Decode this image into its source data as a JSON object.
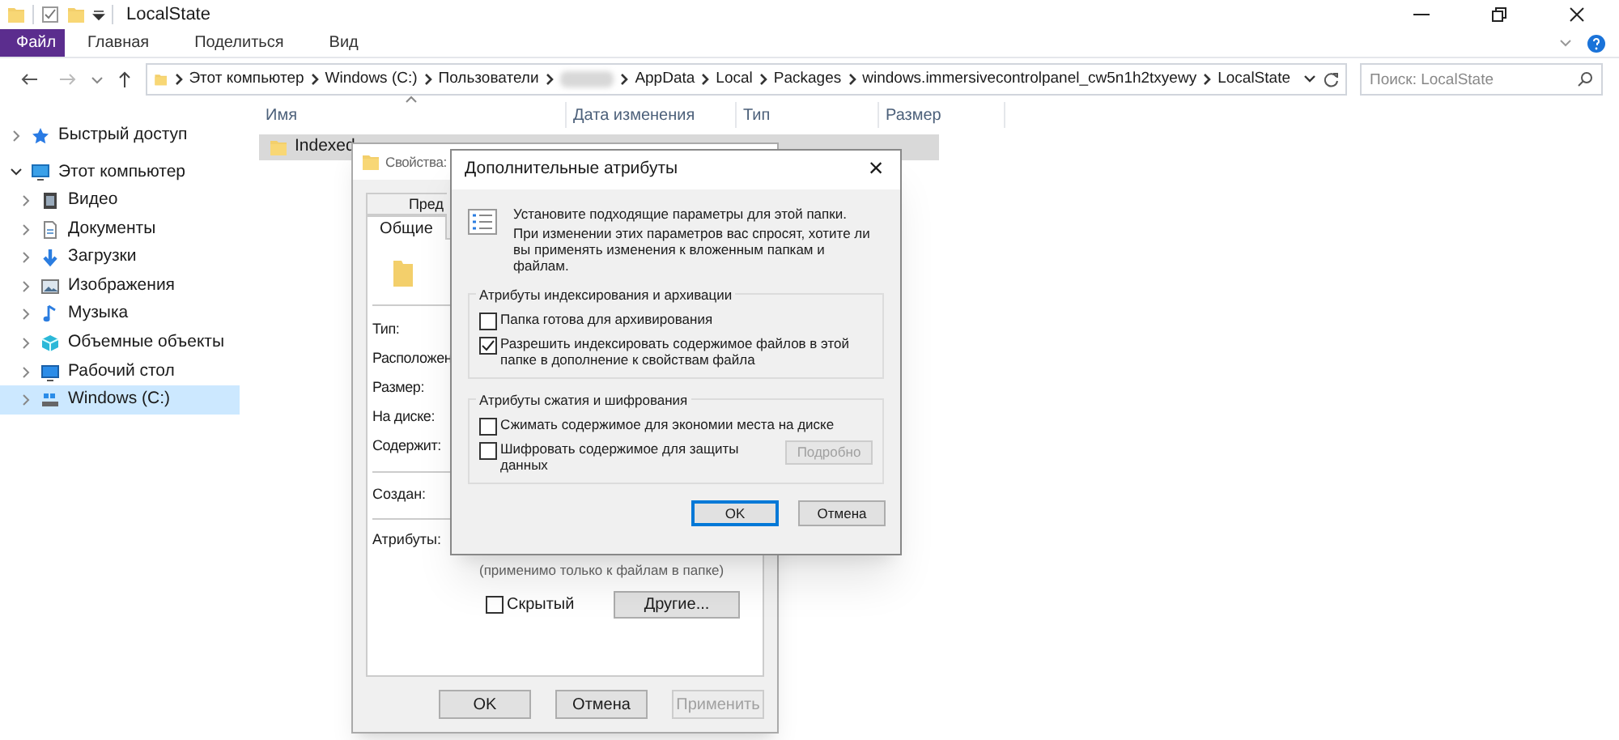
{
  "window": {
    "title": "LocalState"
  },
  "ribbon_tabs": [
    {
      "label": "Файл",
      "selected": true
    },
    {
      "label": "Главная",
      "selected": false
    },
    {
      "label": "Поделиться",
      "selected": false
    },
    {
      "label": "Вид",
      "selected": false
    }
  ],
  "address_bar": {
    "segments": [
      {
        "kind": "text",
        "label": "Этот компьютер"
      },
      {
        "kind": "text",
        "label": "Windows (C:)"
      },
      {
        "kind": "text",
        "label": "Пользователи"
      },
      {
        "kind": "redacted"
      },
      {
        "kind": "text",
        "label": "AppData"
      },
      {
        "kind": "text",
        "label": "Local"
      },
      {
        "kind": "text",
        "label": "Packages"
      },
      {
        "kind": "text",
        "label": "windows.immersivecontrolpanel_cw5n1h2txyewy"
      },
      {
        "kind": "text",
        "label": "LocalState"
      }
    ]
  },
  "search": {
    "placeholder": "Поиск: LocalState"
  },
  "sidebar": {
    "items": [
      {
        "kind": "star",
        "label": "Быстрый доступ",
        "expanded": false,
        "selected": false
      },
      {
        "kind": "computer",
        "label": "Этот компьютер",
        "expanded": true,
        "selected": false,
        "children": [
          {
            "kind": "video",
            "label": "Видео",
            "expanded": false,
            "selected": false
          },
          {
            "kind": "document",
            "label": "Документы",
            "expanded": false,
            "selected": false
          },
          {
            "kind": "download",
            "label": "Загрузки",
            "expanded": false,
            "selected": false
          },
          {
            "kind": "image",
            "label": "Изображения",
            "expanded": false,
            "selected": false
          },
          {
            "kind": "music",
            "label": "Музыка",
            "expanded": false,
            "selected": false
          },
          {
            "kind": "cube",
            "label": "Объемные объекты",
            "expanded": false,
            "selected": false
          },
          {
            "kind": "desktop",
            "label": "Рабочий стол",
            "expanded": false,
            "selected": false
          },
          {
            "kind": "drive",
            "label": "Windows (C:)",
            "expanded": false,
            "selected": true
          }
        ]
      }
    ]
  },
  "file_list": {
    "columns": [
      "Имя",
      "Дата изменения",
      "Тип",
      "Размер"
    ],
    "rows": [
      {
        "name": "Indexed",
        "selected": true
      }
    ]
  },
  "properties_dialog": {
    "title": "Свойства:",
    "tabs": [
      {
        "label": "Пред",
        "selected": false
      },
      {
        "label": "Общие",
        "selected": true
      }
    ],
    "fields": [
      "Тип:",
      "Расположен",
      "Размер:",
      "На диске:",
      "Содержит:"
    ],
    "created_label": "Создан:",
    "attributes_label": "Атрибуты:",
    "note": "(применимо только к файлам в папке)",
    "hidden_checkbox": {
      "label": "Скрытый",
      "checked": false
    },
    "other_button": "Другие...",
    "buttons": [
      {
        "label": "OK",
        "disabled": false
      },
      {
        "label": "Отмена",
        "disabled": false
      },
      {
        "label": "Применить",
        "disabled": true
      }
    ]
  },
  "advanced_dialog": {
    "title": "Дополнительные атрибуты",
    "close": "×",
    "intro": "Установите подходящие параметры для этой папки.",
    "description": "При изменении этих параметров вас спросят, хотите ли вы применять изменения к вложенным папкам и файлам.",
    "groups": [
      {
        "title": "Атрибуты индексирования и архивации",
        "options": [
          {
            "label": "Папка готова для архивирования",
            "checked": false
          },
          {
            "label": "Разрешить индексировать содержимое файлов в этой папке в дополнение к свойствам файла",
            "checked": true
          }
        ]
      },
      {
        "title": "Атрибуты сжатия и шифрования",
        "options": [
          {
            "label": "Сжимать содержимое для экономии места на диске",
            "checked": false
          },
          {
            "label": "Шифровать содержимое для защиты данных",
            "checked": false
          }
        ],
        "button": {
          "label": "Подробно",
          "disabled": true
        }
      }
    ],
    "buttons": [
      {
        "label": "OK",
        "focused": true
      },
      {
        "label": "Отмена",
        "focused": false
      }
    ]
  }
}
